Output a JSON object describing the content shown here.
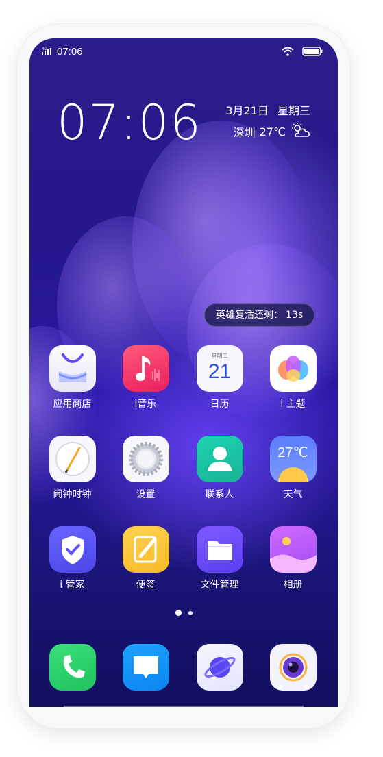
{
  "status_bar": {
    "network": "4G",
    "time": "07:06",
    "wifi_icon": "wifi-icon",
    "battery_icon": "battery-icon"
  },
  "lock": {
    "clock": "07:06",
    "date": "3月21日",
    "weekday": "星期三",
    "city": "深圳",
    "temperature": "27℃",
    "weather_icon": "partly-cloudy-icon"
  },
  "hero": {
    "label": "英雄复活还剩：",
    "seconds": "13s"
  },
  "apps": [
    {
      "label": "应用商店",
      "icon": "app-store-icon"
    },
    {
      "label": "i音乐",
      "icon": "music-icon"
    },
    {
      "label": "日历",
      "icon": "calendar-icon",
      "weekday": "星期三",
      "day": "21"
    },
    {
      "label": "i 主题",
      "icon": "theme-icon"
    },
    {
      "label": "闹钟时钟",
      "icon": "clock-icon"
    },
    {
      "label": "设置",
      "icon": "gear-icon"
    },
    {
      "label": "联系人",
      "icon": "contacts-icon"
    },
    {
      "label": "天气",
      "icon": "weather-icon",
      "temperature": "27℃"
    },
    {
      "label": "i 管家",
      "icon": "shield-icon"
    },
    {
      "label": "便签",
      "icon": "notes-icon"
    },
    {
      "label": "文件管理",
      "icon": "folder-icon"
    },
    {
      "label": "相册",
      "icon": "gallery-icon"
    }
  ],
  "dock": [
    {
      "icon": "phone-icon"
    },
    {
      "icon": "message-icon"
    },
    {
      "icon": "browser-icon"
    },
    {
      "icon": "camera-icon"
    }
  ],
  "page_indicator": {
    "count": 2,
    "active": 1
  }
}
